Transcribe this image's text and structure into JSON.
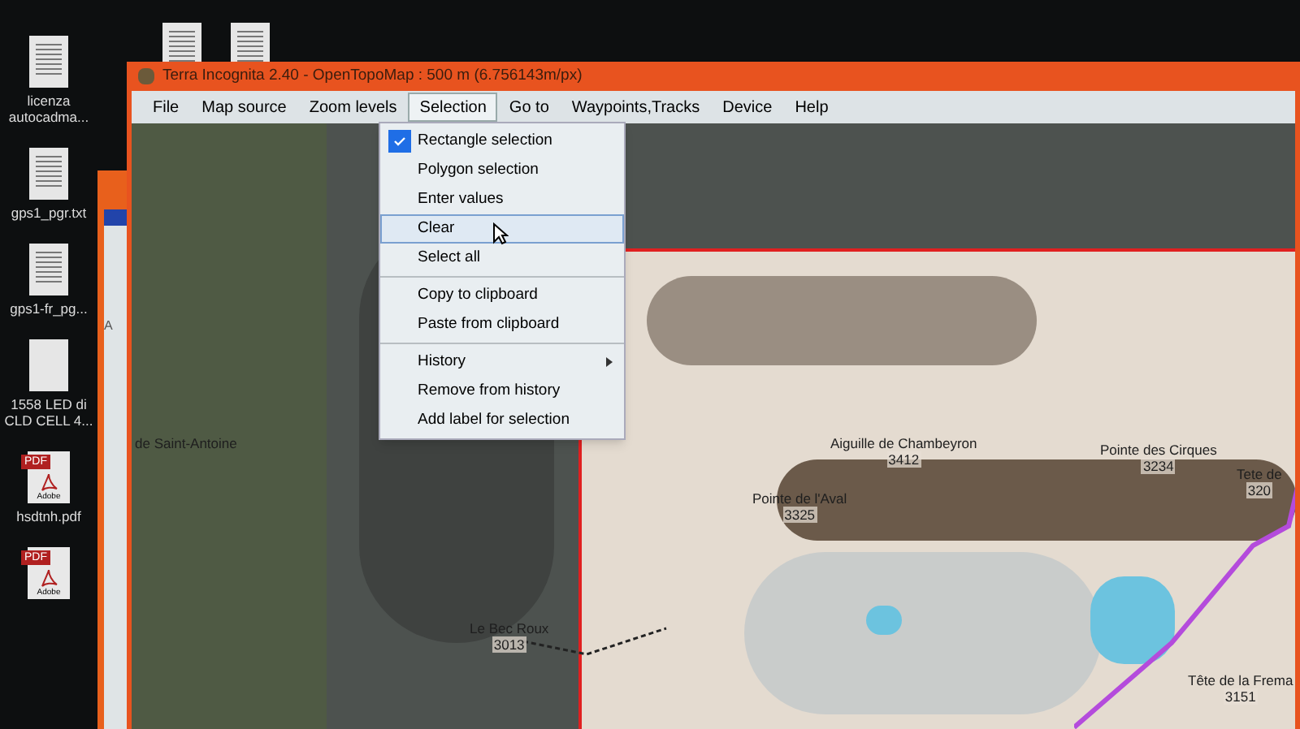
{
  "desktop_icons": [
    {
      "kind": "text",
      "label": "licenza autocadma..."
    },
    {
      "kind": "text",
      "label": "gps1_pgr.txt"
    },
    {
      "kind": "text",
      "label": "gps1-fr_pg..."
    },
    {
      "kind": "blank",
      "label": "1558 LED di CLD CELL 4..."
    },
    {
      "kind": "pdf",
      "badge": "PDF",
      "brand": "Adobe",
      "label": "hsdtnh.pdf"
    },
    {
      "kind": "pdf",
      "badge": "PDF",
      "brand": "Adobe"
    }
  ],
  "top_icons": [
    {
      "kind": "text"
    },
    {
      "kind": "text"
    }
  ],
  "background_window": {
    "text": "A"
  },
  "window": {
    "title": "Terra Incognita 2.40 - OpenTopoMap : 500 m (6.756143m/px)"
  },
  "menu": [
    {
      "label": "File",
      "selected": false
    },
    {
      "label": "Map source",
      "selected": false
    },
    {
      "label": "Zoom levels",
      "selected": false
    },
    {
      "label": "Selection",
      "selected": true
    },
    {
      "label": "Go to",
      "selected": false
    },
    {
      "label": "Waypoints,Tracks",
      "selected": false
    },
    {
      "label": "Device",
      "selected": false
    },
    {
      "label": "Help",
      "selected": false
    }
  ],
  "dropdown": [
    [
      {
        "label": "Rectangle selection",
        "checked": true,
        "selected": false,
        "submenu": false
      },
      {
        "label": "Polygon selection",
        "checked": false,
        "selected": false,
        "submenu": false
      },
      {
        "label": "Enter values",
        "checked": false,
        "selected": false,
        "submenu": false
      },
      {
        "label": "Clear",
        "checked": false,
        "selected": true,
        "submenu": false
      },
      {
        "label": "Select all",
        "checked": false,
        "selected": false,
        "submenu": false
      }
    ],
    [
      {
        "label": "Copy to clipboard",
        "checked": false,
        "selected": false,
        "submenu": false
      },
      {
        "label": "Paste from clipboard",
        "checked": false,
        "selected": false,
        "submenu": false
      }
    ],
    [
      {
        "label": "History",
        "checked": false,
        "selected": false,
        "submenu": true
      },
      {
        "label": "Remove from history",
        "checked": false,
        "selected": false,
        "submenu": false
      },
      {
        "label": "Add label for selection",
        "checked": false,
        "selected": false,
        "submenu": false
      }
    ]
  ],
  "map_labels": [
    {
      "name": "de Saint-Antoine"
    },
    {
      "name": "Aiguille de Chambeyron",
      "elevation": "3412"
    },
    {
      "name": "Pointe des Cirques",
      "elevation": "3234"
    },
    {
      "name": "Tete de",
      "elevation": "320"
    },
    {
      "name": "Pointe de l'Aval",
      "elevation": "3325"
    },
    {
      "name": "Le Bec Roux",
      "elevation": "3013"
    },
    {
      "name": "Tête de la Frema",
      "elevation": "3151"
    }
  ]
}
